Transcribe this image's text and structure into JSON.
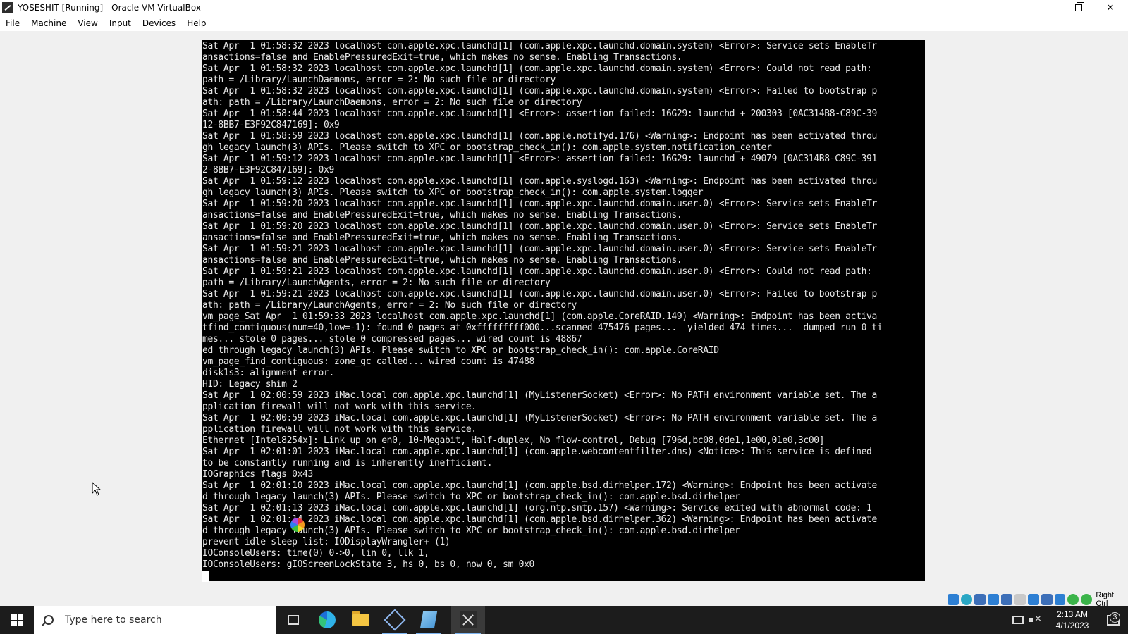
{
  "window": {
    "title": "YOSESHIT [Running] - Oracle VM VirtualBox",
    "minimize": "—",
    "close": "✕"
  },
  "menubar": {
    "items": [
      "File",
      "Machine",
      "View",
      "Input",
      "Devices",
      "Help"
    ]
  },
  "console": {
    "lines": [
      "Sat Apr  1 01:58:32 2023 localhost com.apple.xpc.launchd[1] (com.apple.xpc.launchd.domain.system) <Error>: Service sets EnableTr",
      "ansactions=false and EnablePressuredExit=true, which makes no sense. Enabling Transactions.",
      "Sat Apr  1 01:58:32 2023 localhost com.apple.xpc.launchd[1] (com.apple.xpc.launchd.domain.system) <Error>: Could not read path:",
      "path = /Library/LaunchDaemons, error = 2: No such file or directory",
      "Sat Apr  1 01:58:32 2023 localhost com.apple.xpc.launchd[1] (com.apple.xpc.launchd.domain.system) <Error>: Failed to bootstrap p",
      "ath: path = /Library/LaunchDaemons, error = 2: No such file or directory",
      "Sat Apr  1 01:58:44 2023 localhost com.apple.xpc.launchd[1] <Error>: assertion failed: 16G29: launchd + 200303 [0AC314B8-C89C-39",
      "12-8BB7-E3F92C847169]: 0x9",
      "Sat Apr  1 01:58:59 2023 localhost com.apple.xpc.launchd[1] (com.apple.notifyd.176) <Warning>: Endpoint has been activated throu",
      "gh legacy launch(3) APIs. Please switch to XPC or bootstrap_check_in(): com.apple.system.notification_center",
      "Sat Apr  1 01:59:12 2023 localhost com.apple.xpc.launchd[1] <Error>: assertion failed: 16G29: launchd + 49079 [0AC314B8-C89C-391",
      "2-8BB7-E3F92C847169]: 0x9",
      "Sat Apr  1 01:59:12 2023 localhost com.apple.xpc.launchd[1] (com.apple.syslogd.163) <Warning>: Endpoint has been activated throu",
      "gh legacy launch(3) APIs. Please switch to XPC or bootstrap_check_in(): com.apple.system.logger",
      "Sat Apr  1 01:59:20 2023 localhost com.apple.xpc.launchd[1] (com.apple.xpc.launchd.domain.user.0) <Error>: Service sets EnableTr",
      "ansactions=false and EnablePressuredExit=true, which makes no sense. Enabling Transactions.",
      "Sat Apr  1 01:59:20 2023 localhost com.apple.xpc.launchd[1] (com.apple.xpc.launchd.domain.user.0) <Error>: Service sets EnableTr",
      "ansactions=false and EnablePressuredExit=true, which makes no sense. Enabling Transactions.",
      "Sat Apr  1 01:59:21 2023 localhost com.apple.xpc.launchd[1] (com.apple.xpc.launchd.domain.user.0) <Error>: Service sets EnableTr",
      "ansactions=false and EnablePressuredExit=true, which makes no sense. Enabling Transactions.",
      "Sat Apr  1 01:59:21 2023 localhost com.apple.xpc.launchd[1] (com.apple.xpc.launchd.domain.user.0) <Error>: Could not read path:",
      "path = /Library/LaunchAgents, error = 2: No such file or directory",
      "Sat Apr  1 01:59:21 2023 localhost com.apple.xpc.launchd[1] (com.apple.xpc.launchd.domain.user.0) <Error>: Failed to bootstrap p",
      "ath: path = /Library/LaunchAgents, error = 2: No such file or directory",
      "vm_page_Sat Apr  1 01:59:33 2023 localhost com.apple.xpc.launchd[1] (com.apple.CoreRAID.149) <Warning>: Endpoint has been activa",
      "tfind_contiguous(num=40,low=-1): found 0 pages at 0xfffffffff000...scanned 475476 pages...  yielded 474 times...  dumped run 0 ti",
      "mes... stole 0 pages... stole 0 compressed pages... wired count is 48867",
      "ed through legacy launch(3) APIs. Please switch to XPC or bootstrap_check_in(): com.apple.CoreRAID",
      "vm_page_find_contiguous: zone_gc called... wired count is 47488",
      "disk1s3: alignment error.",
      "HID: Legacy shim 2",
      "Sat Apr  1 02:00:59 2023 iMac.local com.apple.xpc.launchd[1] (MyListenerSocket) <Error>: No PATH environment variable set. The a",
      "pplication firewall will not work with this service.",
      "Sat Apr  1 02:00:59 2023 iMac.local com.apple.xpc.launchd[1] (MyListenerSocket) <Error>: No PATH environment variable set. The a",
      "pplication firewall will not work with this service.",
      "Ethernet [Intel8254x]: Link up on en0, 10-Megabit, Half-duplex, No flow-control, Debug [796d,bc08,0de1,1e00,01e0,3c00]",
      "Sat Apr  1 02:01:01 2023 iMac.local com.apple.xpc.launchd[1] (com.apple.webcontentfilter.dns) <Notice>: This service is defined",
      "to be constantly running and is inherently inefficient.",
      "IOGraphics flags 0x43",
      "Sat Apr  1 02:01:10 2023 iMac.local com.apple.xpc.launchd[1] (com.apple.bsd.dirhelper.172) <Warning>: Endpoint has been activate",
      "d through legacy launch(3) APIs. Please switch to XPC or bootstrap_check_in(): com.apple.bsd.dirhelper",
      "Sat Apr  1 02:01:13 2023 iMac.local com.apple.xpc.launchd[1] (org.ntp.sntp.157) <Warning>: Service exited with abnormal code: 1",
      "Sat Apr  1 02:01:14 2023 iMac.local com.apple.xpc.launchd[1] (com.apple.bsd.dirhelper.362) <Warning>: Endpoint has been activate",
      "d through legacy launch(3) APIs. Please switch to XPC or bootstrap_check_in(): com.apple.bsd.dirhelper",
      "prevent idle sleep list: IODisplayWrangler+ (1)",
      "IOConsoleUsers: time(0) 0->0, lin 0, llk 1,",
      "IOConsoleUsers: gIOScreenLockState 3, hs 0, bs 0, now 0, sm 0x0"
    ]
  },
  "vbox_status": {
    "icons": [
      "hard-disk-icon",
      "optical-drive-icon",
      "audio-icon",
      "network-icon",
      "usb-icon",
      "shared-folders-icon",
      "display-icon",
      "video-capture-icon",
      "cpu-icon",
      "mouse-integration-icon",
      "keyboard-icon"
    ],
    "host_key": "Right Ctrl"
  },
  "taskbar": {
    "search_placeholder": "Type here to search",
    "apps": [
      "task-view-icon",
      "edge-icon",
      "file-explorer-icon",
      "virtualbox-icon",
      "notepad-icon",
      "x-terminal-icon"
    ],
    "clock_time": "2:13 AM",
    "clock_date": "4/1/2023",
    "notification_count": "3"
  }
}
